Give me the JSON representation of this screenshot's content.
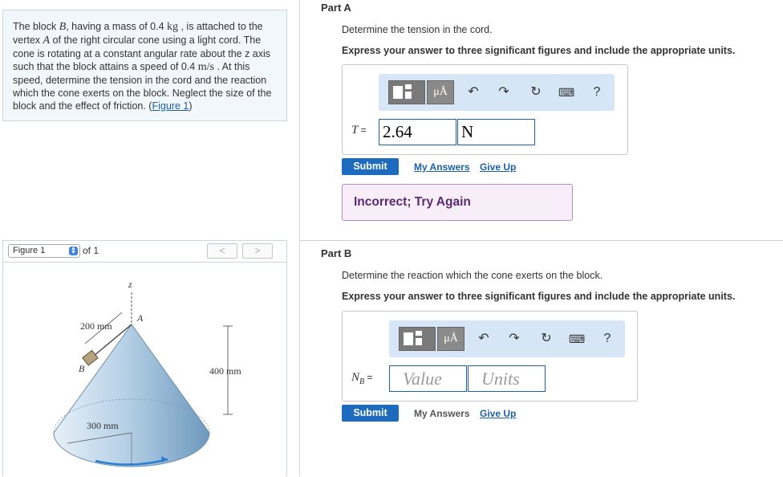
{
  "problem": {
    "text_1": "The block ",
    "var_B": "B",
    "text_2": ", having a mass of 0.4 ",
    "unit_kg": "kg",
    "text_3": " , is attached to the vertex ",
    "var_A": "A",
    "text_4": " of the right circular cone using a light cord. The cone is rotating at a constant angular rate about the z axis such that the block attains a speed of 0.4 ",
    "unit_ms": "m/s",
    "text_5": " . At this speed, determine the tension in the cord and the reaction which the cone exerts on the block. Neglect the size of the block and the effect of friction. (",
    "figure_link": "Figure 1",
    "text_6": ")"
  },
  "figure": {
    "select_value": "Figure 1",
    "of_text": "of 1",
    "prev": "<",
    "next": ">",
    "labels": {
      "z": "z",
      "a": "A",
      "b": "B",
      "d200": "200 mm",
      "d400": "400 mm",
      "d300": "300 mm"
    },
    "colors": {
      "cone_light": "#dceaf5",
      "cone_dark": "#7ba6c8",
      "block": "#b8a886",
      "arrow": "#2a7fd1"
    }
  },
  "partA": {
    "title": "Part A",
    "prompt": "Determine the tension in the cord.",
    "instruction": "Express your answer to three significant figures and include the appropriate units.",
    "toolbar": {
      "mu": "μÅ",
      "help": "?"
    },
    "var": "T",
    "eq": " =",
    "value": "2.64",
    "units": "N",
    "submit": "Submit",
    "my_answers": "My Answers",
    "give_up": "Give Up",
    "feedback": "Incorrect; Try Again"
  },
  "partB": {
    "title": "Part B",
    "prompt": "Determine the reaction which the cone exerts on the block.",
    "instruction": "Express your answer to three significant figures and include the appropriate units.",
    "toolbar": {
      "mu": "μÅ",
      "help": "?"
    },
    "var": "N",
    "var_sub": "B",
    "eq": " =",
    "value_placeholder": "Value",
    "units_placeholder": "Units",
    "submit": "Submit",
    "my_answers": "My Answers",
    "give_up": "Give Up"
  }
}
